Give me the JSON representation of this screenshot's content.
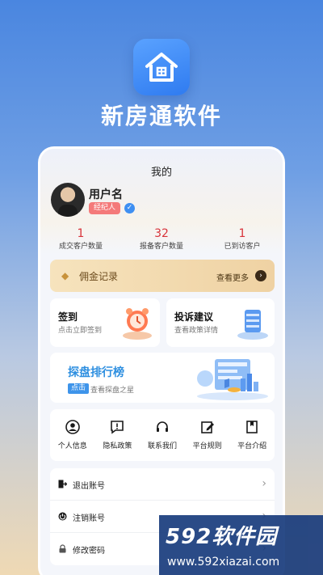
{
  "app": {
    "name": "新房通软件",
    "icon": "house-icon"
  },
  "screen": {
    "title": "我的"
  },
  "profile": {
    "username": "用户名",
    "role": "经纪人",
    "verified_icon": "v-verified-icon"
  },
  "stats": [
    {
      "value": "1",
      "label": "成交客户数量"
    },
    {
      "value": "32",
      "label": "报备客户数量"
    },
    {
      "value": "1",
      "label": "已到访客户"
    }
  ],
  "commission": {
    "label": "佣金记录",
    "more": "查看更多"
  },
  "cards": {
    "checkin": {
      "title": "签到",
      "subtitle": "点击立即签到"
    },
    "complaint": {
      "title": "投诉建议",
      "subtitle": "查看政策详情"
    },
    "rank": {
      "title": "探盘排行榜",
      "badge": "点击",
      "subtitle": "查看探盘之星"
    }
  },
  "quick_links": [
    {
      "label": "个人信息",
      "icon": "user-icon"
    },
    {
      "label": "隐私政策",
      "icon": "alert-chat-icon"
    },
    {
      "label": "联系我们",
      "icon": "headset-icon"
    },
    {
      "label": "平台规则",
      "icon": "edit-icon"
    },
    {
      "label": "平台介绍",
      "icon": "bookmark-icon"
    }
  ],
  "menu": [
    {
      "label": "退出账号",
      "icon": "logout-icon"
    },
    {
      "label": "注销账号",
      "icon": "power-icon"
    },
    {
      "label": "修改密码",
      "icon": "lock-icon"
    }
  ],
  "watermark": {
    "logo": "592软件园",
    "url": "www.592xiazai.com"
  },
  "colors": {
    "accent": "#3e8ff2",
    "stat": "#d8333a",
    "gold": "#efd2a3"
  }
}
